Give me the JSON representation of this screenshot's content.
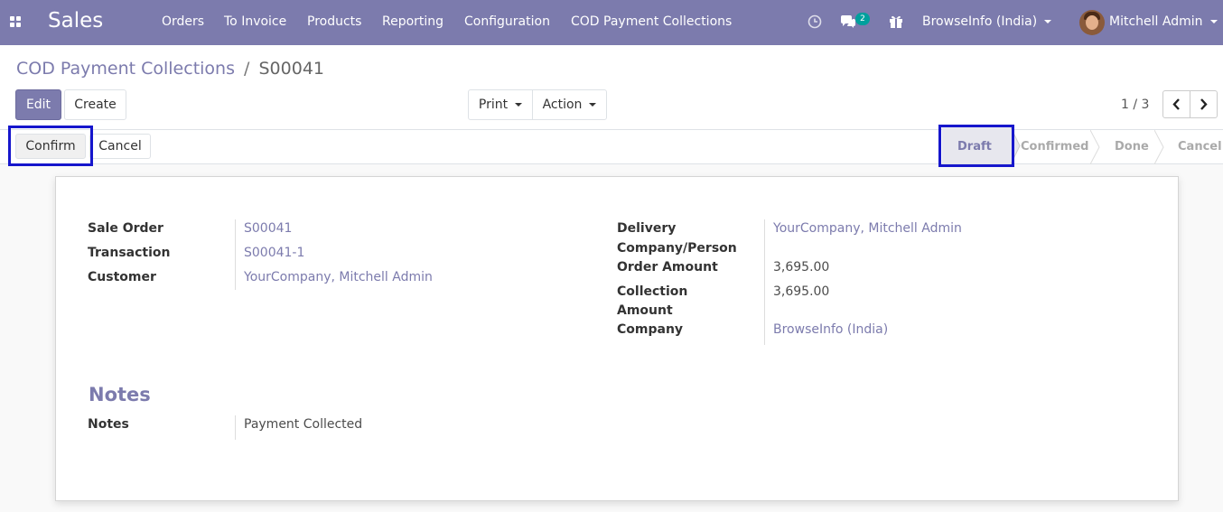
{
  "navbar": {
    "brand": "Sales",
    "menu": [
      "Orders",
      "To Invoice",
      "Products",
      "Reporting",
      "Configuration",
      "COD Payment Collections"
    ],
    "messages_count": "2",
    "company": "BrowseInfo (India)",
    "user": "Mitchell Admin"
  },
  "breadcrumb": {
    "parent": "COD Payment Collections",
    "separator": "/",
    "current": "S00041"
  },
  "toolbar": {
    "edit": "Edit",
    "create": "Create",
    "print": "Print",
    "action": "Action"
  },
  "pager": {
    "value": "1 / 3"
  },
  "statusbar": {
    "confirm": "Confirm",
    "cancel": "Cancel",
    "stages": [
      "Draft",
      "Confirmed",
      "Done",
      "Cancel"
    ],
    "active_stage": "Draft"
  },
  "form": {
    "left": [
      {
        "label": "Sale Order",
        "value": "S00041"
      },
      {
        "label": "Transaction",
        "value": "S00041-1"
      },
      {
        "label": "Customer",
        "value": "YourCompany, Mitchell Admin"
      }
    ],
    "right": {
      "delivery_label_1": "Delivery",
      "delivery_label_2": "Company/Person",
      "delivery_value": "YourCompany, Mitchell Admin",
      "order_amount_label": "Order Amount",
      "order_amount_value": "3,695.00",
      "collection_label_1": "Collection",
      "collection_label_2": "Amount",
      "collection_value": "3,695.00",
      "company_label": "Company",
      "company_value": "BrowseInfo (India)"
    },
    "notes_section": "Notes",
    "notes_label": "Notes",
    "notes_value": "Payment Collected"
  },
  "colors": {
    "brand": "#7c7bad",
    "highlight": "#1616cc"
  }
}
